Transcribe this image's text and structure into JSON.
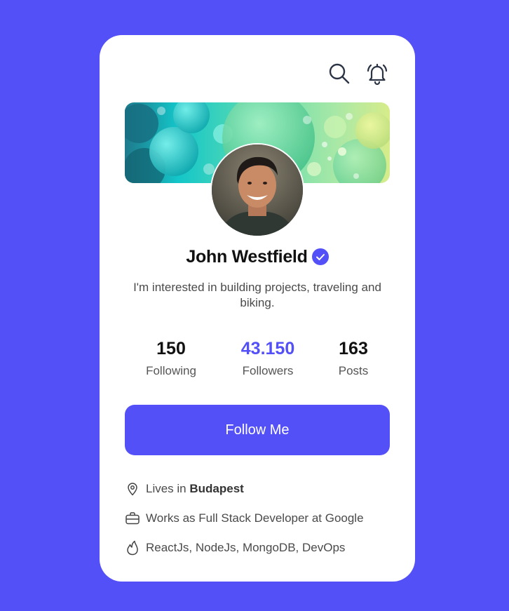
{
  "profile": {
    "name": "John Westfield",
    "bio": "I'm interested in building projects, traveling and biking."
  },
  "stats": [
    {
      "value": "150",
      "label": "Following"
    },
    {
      "value": "43.150",
      "label": "Followers"
    },
    {
      "value": "163",
      "label": "Posts"
    }
  ],
  "actions": {
    "follow_label": "Follow Me"
  },
  "info": {
    "location_prefix": "Lives in ",
    "location_city": "Budapest",
    "work": "Works as Full Stack Developer at Google",
    "skills": "ReactJs, NodeJs, MongoDB, DevOps"
  },
  "icons": {
    "search": "search-icon",
    "notifications": "bell-icon",
    "verified": "verified-badge-icon",
    "location": "map-pin-icon",
    "work": "briefcase-icon",
    "skills": "flame-icon"
  },
  "colors": {
    "background": "#5450f7",
    "accent": "#5450f7",
    "card": "#ffffff",
    "text_primary": "#111111",
    "text_secondary": "#4a4a4a"
  }
}
